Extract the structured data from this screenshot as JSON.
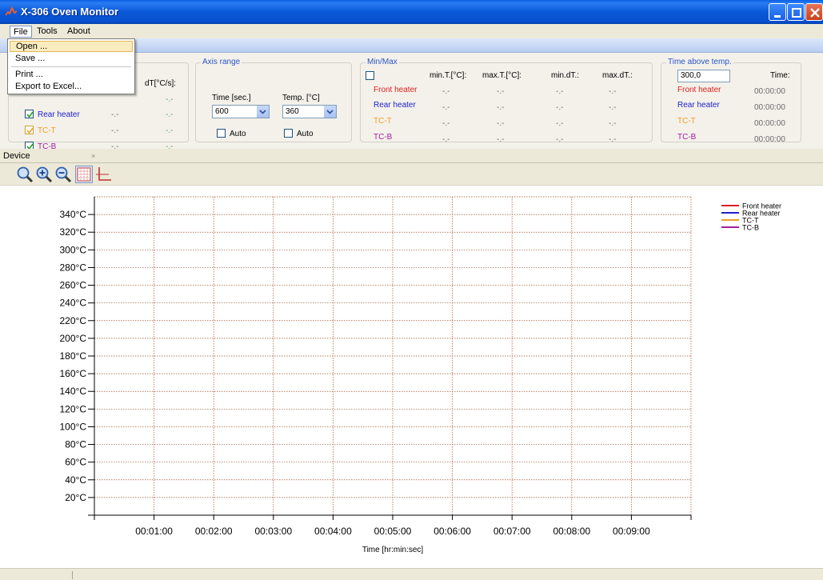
{
  "window": {
    "title": "X-306 Oven Monitor",
    "accent": "#0a58d8"
  },
  "menu": {
    "file": "File",
    "tools": "Tools",
    "about": "About",
    "file_items": [
      "Open ...",
      "Save ...",
      "Print ...",
      "Export to Excel..."
    ]
  },
  "channels": {
    "header_dt": "dT[°C/s]:",
    "rows": [
      {
        "name": "Rear heater",
        "value": "-.-",
        "dt": "-.-",
        "color": "#2222cc"
      },
      {
        "name": "TC-T",
        "value": "-.-",
        "dt": "-.-",
        "color": "#f0a020"
      },
      {
        "name": "TC-B",
        "value": "-.-",
        "dt": "-.-",
        "color": "#a020a0"
      }
    ],
    "hidden_dt": "-.-"
  },
  "axis_range": {
    "legend": "Axis range",
    "time_label": "Time [sec.]",
    "temp_label": "Temp. [°C]",
    "time_value": "600",
    "temp_value": "360",
    "auto_label": "Auto"
  },
  "minmax": {
    "legend": "Min/Max",
    "headers": [
      "min.T.[°C]:",
      "max.T.[°C]:",
      "min.dT.:",
      "max.dT.:"
    ],
    "rows": [
      {
        "name": "Front heater",
        "color": "#e02020",
        "values": [
          "-.-",
          "-.-",
          "-.-",
          "-.-"
        ]
      },
      {
        "name": "Rear heater",
        "color": "#2222cc",
        "values": [
          "-.-",
          "-.-",
          "-.-",
          "-.-"
        ]
      },
      {
        "name": "TC-T",
        "color": "#f0a020",
        "values": [
          "-.-",
          "-.-",
          "-.-",
          "-.-"
        ]
      },
      {
        "name": "TC-B",
        "color": "#a020a0",
        "values": [
          "-.-",
          "-.-",
          "-.-",
          "-.-"
        ]
      }
    ]
  },
  "time_above": {
    "legend": "Time above temp.",
    "input_value": "300,0",
    "time_header": "Time:",
    "rows": [
      {
        "name": "Front heater",
        "color": "#e02020",
        "time": "00:00:00"
      },
      {
        "name": "Rear heater",
        "color": "#2222cc",
        "time": "00:00:00"
      },
      {
        "name": "TC-T",
        "color": "#f0a020",
        "time": "00:00:00"
      },
      {
        "name": "TC-B",
        "color": "#a020a0",
        "time": "00:00:00"
      }
    ]
  },
  "device_tab": {
    "label": "Device",
    "close": "×"
  },
  "chart_data": {
    "type": "line",
    "xlabel": "Time [hr:min:sec]",
    "ylabel": "",
    "y_ticks": [
      20,
      40,
      60,
      80,
      100,
      120,
      140,
      160,
      180,
      200,
      220,
      240,
      260,
      280,
      300,
      320,
      340
    ],
    "y_tick_labels": [
      "20°C",
      "40°C",
      "60°C",
      "80°C",
      "100°C",
      "120°C",
      "140°C",
      "160°C",
      "180°C",
      "200°C",
      "220°C",
      "240°C",
      "260°C",
      "280°C",
      "300°C",
      "320°C",
      "340°C"
    ],
    "ylim": [
      0,
      360
    ],
    "x_ticks": [
      60,
      120,
      180,
      240,
      300,
      360,
      420,
      480,
      540
    ],
    "x_tick_labels": [
      "00:01:00",
      "00:02:00",
      "00:03:00",
      "00:04:00",
      "00:05:00",
      "00:06:00",
      "00:07:00",
      "00:08:00",
      "00:09:00"
    ],
    "xlim": [
      0,
      600
    ],
    "grid": true,
    "grid_color": "#a0522d",
    "legend_position": "top-right",
    "series": [
      {
        "name": "Front heater",
        "color": "#e02020",
        "values": []
      },
      {
        "name": "Rear heater",
        "color": "#2222cc",
        "values": []
      },
      {
        "name": "TC-T",
        "color": "#f0a020",
        "values": []
      },
      {
        "name": "TC-B",
        "color": "#a020a0",
        "values": []
      }
    ]
  }
}
